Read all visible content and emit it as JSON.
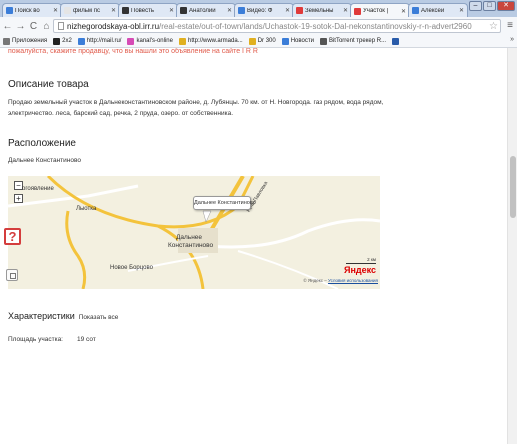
{
  "browser": {
    "tabs": [
      {
        "title": "Поиск во",
        "color": "#3b7dd8"
      },
      {
        "title": "фильм пс",
        "color": "#e5e5e5"
      },
      {
        "title": "Повесть",
        "color": "#333333"
      },
      {
        "title": "Анатолий",
        "color": "#333333"
      },
      {
        "title": "Видео: Ф",
        "color": "#3b7dd8"
      },
      {
        "title": "Земельны",
        "color": "#e03a3a"
      },
      {
        "title": "Участок |",
        "color": "#e03a3a"
      },
      {
        "title": "Алексей",
        "color": "#3b7dd8"
      }
    ],
    "active_tab": 6,
    "url_host": "nizhegorodskaya-obl.irr.ru",
    "url_path": "/real-estate/out-of-town/lands/Uchastok-19-sotok-Dal-nekonstantinovskiy-r-n-advert2960",
    "bookmarks": [
      {
        "label": "Приложения",
        "color": "#777777"
      },
      {
        "label": "2x2",
        "color": "#222222"
      },
      {
        "label": "http://mail.ru/",
        "color": "#3b7dd8"
      },
      {
        "label": "kanal's-online",
        "color": "#d64bb5"
      },
      {
        "label": "http://www.armada...",
        "color": "#e0b021"
      },
      {
        "label": "Dr 300",
        "color": "#e0b021"
      },
      {
        "label": "Новости",
        "color": "#3b7dd8"
      },
      {
        "label": "BitTorrent трекер R...",
        "color": "#555555"
      },
      {
        "label": "",
        "color": "#2a5caa"
      }
    ],
    "bookmarks_more": "»"
  },
  "page": {
    "cut_text": "пожалуйста, скажите продавцу, что вы нашли это объявление на сайте I R R",
    "description_heading": "Описание товара",
    "description_text": "Продаю земельный участок в Дальнеконстантиновском районе, д. Лубянцы. 70 км. от Н. Новгорода. газ рядом, вода рядом, электричество. леса, барский сад, речка, 2 пруда, озеро. от собственника.",
    "location_heading": "Расположение",
    "location_name": "Дальнее Константиново",
    "characteristics_heading": "Характеристики",
    "show_all": "Показать все",
    "area_label": "Площадь участка:",
    "area_value": "19 сот"
  },
  "map": {
    "balloon": "Дальнее Константиново",
    "city_line1": "Дальнее",
    "city_line2": "Константиново",
    "label_village1": "огоявление",
    "label_village2": "Лыотка",
    "label_village3": "Новое Борцово",
    "label_road": "Речь-Павловка",
    "scale_text": "2 км",
    "logo": "Яндекс",
    "copyright": "© Яндекс –",
    "terms": "Условия использования",
    "zoom_in": "+",
    "zoom_out": "−"
  },
  "colors": {
    "accent": "#d43d3d",
    "link": "#1a4f9e",
    "road": "#f3c33c"
  }
}
